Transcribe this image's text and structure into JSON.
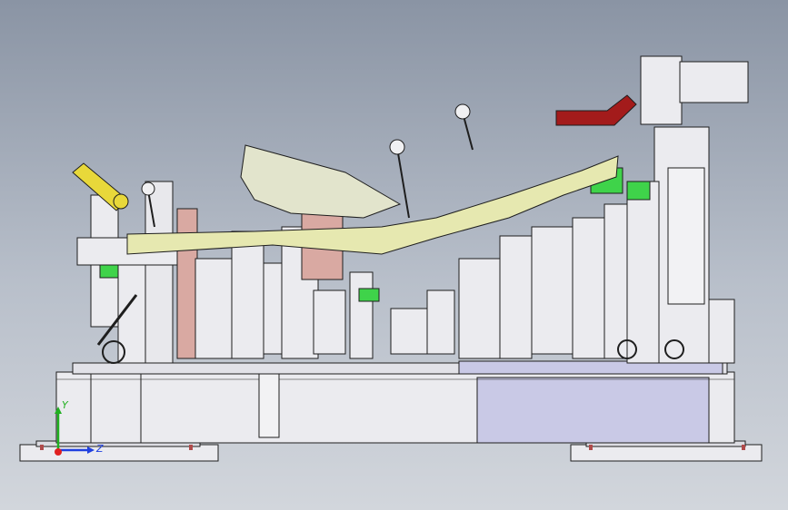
{
  "viewport": {
    "background_top": "#8a94a4",
    "background_bottom": "#d2d6dc"
  },
  "model": {
    "part_color": "#e6e8b0",
    "frame_color": "#ebebef",
    "base_shade_color": "#c9c9e6",
    "clamp_green": "#3fd34a",
    "arm_red": "#a31b1b",
    "handle_yellow": "#e8d83a",
    "pink_bracket": "#d9a9a2",
    "outline_color": "#1e1e1e"
  },
  "triad": {
    "labels": {
      "y": "Y",
      "z": "Z"
    },
    "colors": {
      "x": "#e02020",
      "y": "#20b020",
      "z": "#2040e0"
    }
  }
}
